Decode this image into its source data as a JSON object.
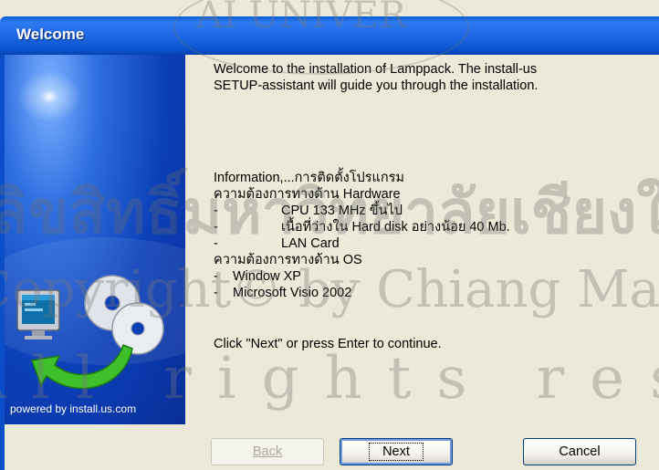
{
  "window": {
    "title": "Welcome"
  },
  "sidebar": {
    "powered_by": "powered by install.us.com"
  },
  "content": {
    "intro_line1": "Welcome to the installation of Lamppack. The install-us",
    "intro_line2": "SETUP-assistant will guide you through the installation.",
    "info_heading": "Information,...การติดตั้งโปรแกรม",
    "hw_heading": "ความต้องการทางด้าน Hardware",
    "hw_items": [
      {
        "bullet": "-",
        "text": "CPU 133 MHz ขึ้นไป"
      },
      {
        "bullet": "-",
        "text": "เนื้อที่ว่างใน Hard disk อย่างน้อย  40 Mb."
      },
      {
        "bullet": "-",
        "text": "LAN Card"
      }
    ],
    "os_heading": "ความต้องการทางด้าน OS",
    "os_items": [
      {
        "bullet": "-",
        "text": "Window XP"
      },
      {
        "bullet": "-",
        "text": "Microsoft Visio 2002"
      }
    ],
    "continue_text": "Click \"Next\" or press Enter to continue."
  },
  "buttons": {
    "back": "Back",
    "next": "Next",
    "cancel": "Cancel"
  },
  "watermark": {
    "top": "AI UNIVER",
    "line1": "ลิขสิทธิ์มหาวิทยาลัยเชียงใหม่",
    "line2": "Copyright© by Chiang Mai University",
    "line3": "All rights reserved"
  },
  "colors": {
    "titlebar": "#0b55cf",
    "sidebar": "#0b3fb8",
    "dialog_bg": "#ece9d8"
  }
}
